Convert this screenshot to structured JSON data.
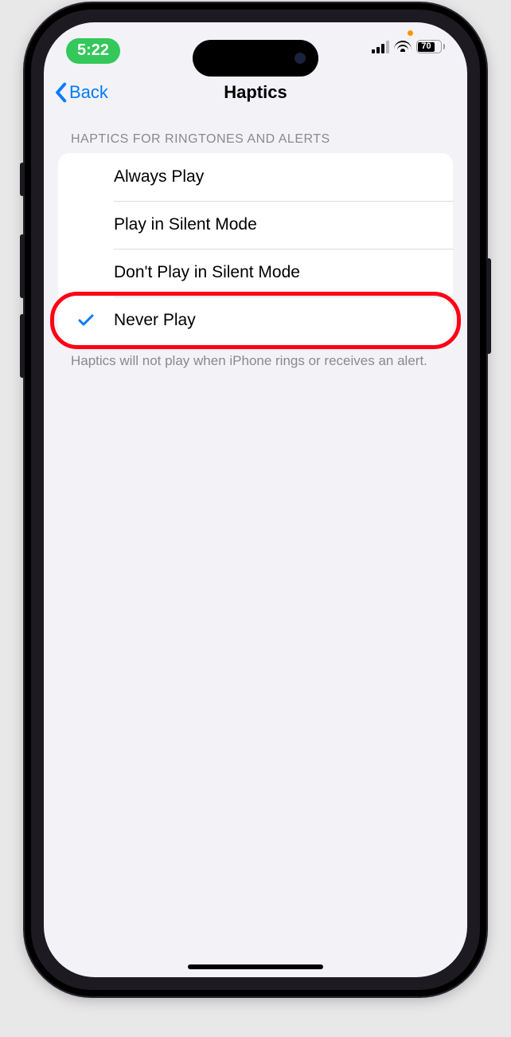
{
  "status": {
    "time": "5:22",
    "battery_pct": "70",
    "signal_bars_shown": 4
  },
  "nav": {
    "back_label": "Back",
    "title": "Haptics"
  },
  "section": {
    "title": "HAPTICS FOR RINGTONES AND ALERTS",
    "options": [
      {
        "label": "Always Play"
      },
      {
        "label": "Play in Silent Mode"
      },
      {
        "label": "Don't Play in Silent Mode"
      },
      {
        "label": "Never Play",
        "selected": true,
        "annotated": true
      }
    ],
    "footnote": "Haptics will not play when iPhone rings or receives an alert."
  }
}
